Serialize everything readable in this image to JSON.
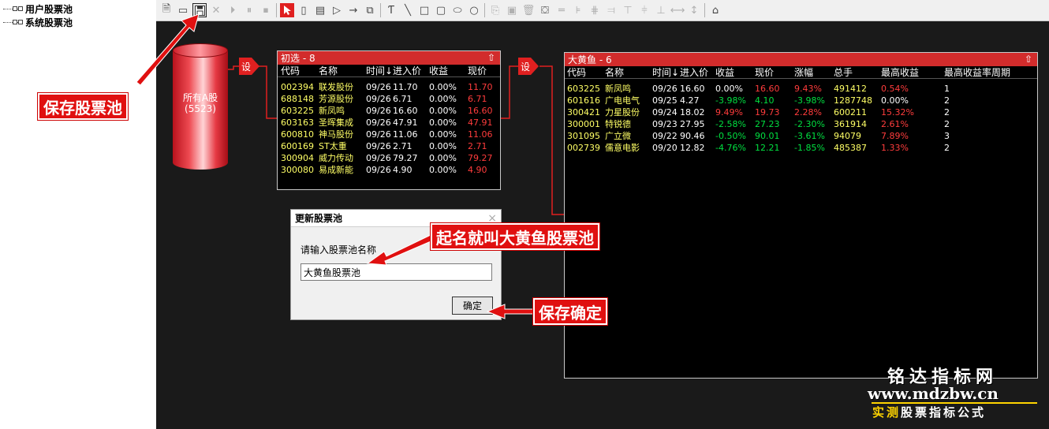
{
  "tree": {
    "items": [
      {
        "label": "用户股票池"
      },
      {
        "label": "系统股票池"
      }
    ]
  },
  "toolbar": {
    "icons": [
      "new-icon",
      "open-icon",
      "save-icon",
      "delete-icon",
      "play-icon",
      "pause-icon",
      "stop-icon",
      "pointer-icon",
      "cylinder-icon",
      "note-icon",
      "triangle-icon",
      "arrow-icon",
      "copy-node-icon",
      "text-icon",
      "line-icon",
      "rect-icon",
      "rounded-rect-icon",
      "ellipse-icon",
      "circle-icon",
      "copy-icon",
      "paste-icon",
      "trash-icon",
      "fill-icon",
      "line-style-icon",
      "align-left-icon",
      "align-center-icon",
      "align-right-icon",
      "align-top-icon",
      "align-middle-icon",
      "align-bottom-icon",
      "same-width-icon",
      "same-height-icon",
      "home-icon"
    ]
  },
  "pool": {
    "name": "所有A股",
    "count": "(5523)"
  },
  "nodes": {
    "filter1": "设",
    "filter2": "设"
  },
  "panel_initial": {
    "title": "初选 - 8",
    "columns": [
      "代码",
      "名称",
      "时间↓",
      "进入价",
      "收益",
      "现价"
    ],
    "rows": [
      [
        "002394",
        "联发股份",
        "09/26",
        "11.70",
        "0.00%",
        "11.70"
      ],
      [
        "688148",
        "芳源股份",
        "09/26",
        "6.71",
        "0.00%",
        "6.71"
      ],
      [
        "603225",
        "新凤鸣",
        "09/26",
        "16.60",
        "0.00%",
        "16.60"
      ],
      [
        "603163",
        "圣晖集成",
        "09/26",
        "47.91",
        "0.00%",
        "47.91"
      ],
      [
        "600810",
        "神马股份",
        "09/26",
        "11.06",
        "0.00%",
        "11.06"
      ],
      [
        "600169",
        "ST太重",
        "09/26",
        "2.71",
        "0.00%",
        "2.71"
      ],
      [
        "300904",
        "威力传动",
        "09/26",
        "79.27",
        "0.00%",
        "79.27"
      ],
      [
        "300080",
        "易成新能",
        "09/26",
        "4.90",
        "0.00%",
        "4.90"
      ]
    ]
  },
  "panel_pool": {
    "title": "大黄鱼 - 6",
    "columns": [
      "代码",
      "名称",
      "时间↓",
      "进入价",
      "收益",
      "现价",
      "涨幅",
      "总手",
      "最高收益",
      "最高收益率周期"
    ],
    "rows": [
      [
        "603225",
        "新凤鸣",
        "09/26",
        "16.60",
        "0.00%",
        "16.60",
        "9.43%",
        "491412",
        "0.54%",
        "1"
      ],
      [
        "601616",
        "广电电气",
        "09/25",
        "4.27",
        "-3.98%",
        "4.10",
        "-3.98%",
        "1287748",
        "0.00%",
        "2"
      ],
      [
        "300421",
        "力星股份",
        "09/24",
        "18.02",
        "9.49%",
        "19.73",
        "2.28%",
        "600211",
        "15.32%",
        "2"
      ],
      [
        "300001",
        "特锐德",
        "09/23",
        "27.95",
        "-2.58%",
        "27.23",
        "-2.30%",
        "361914",
        "2.61%",
        "2"
      ],
      [
        "301095",
        "广立微",
        "09/22",
        "90.46",
        "-0.50%",
        "90.01",
        "-3.61%",
        "94079",
        "7.89%",
        "3"
      ],
      [
        "002739",
        "儒意电影",
        "09/20",
        "12.82",
        "-4.76%",
        "12.21",
        "-1.85%",
        "485387",
        "1.33%",
        "2"
      ]
    ]
  },
  "dialog": {
    "title": "更新股票池",
    "close": "×",
    "prompt": "请输入股票池名称",
    "value": "大黄鱼股票池",
    "ok": "确定"
  },
  "callouts": {
    "save_pool": "保存股票池",
    "name_it": "起名就叫大黄鱼股票池",
    "save_confirm": "保存确定"
  },
  "watermark": {
    "line1": "铭达指标网",
    "line2": "www.mdzbw.cn",
    "line3_hl": "实测",
    "line3": "股票指标公式"
  },
  "colors": {
    "canvas_bg": "#1a1a1a",
    "panel_header": "#d22c2c",
    "up": "#ff3c3c",
    "down": "#00e040",
    "code": "#ffff66",
    "callout": "#e01010"
  }
}
